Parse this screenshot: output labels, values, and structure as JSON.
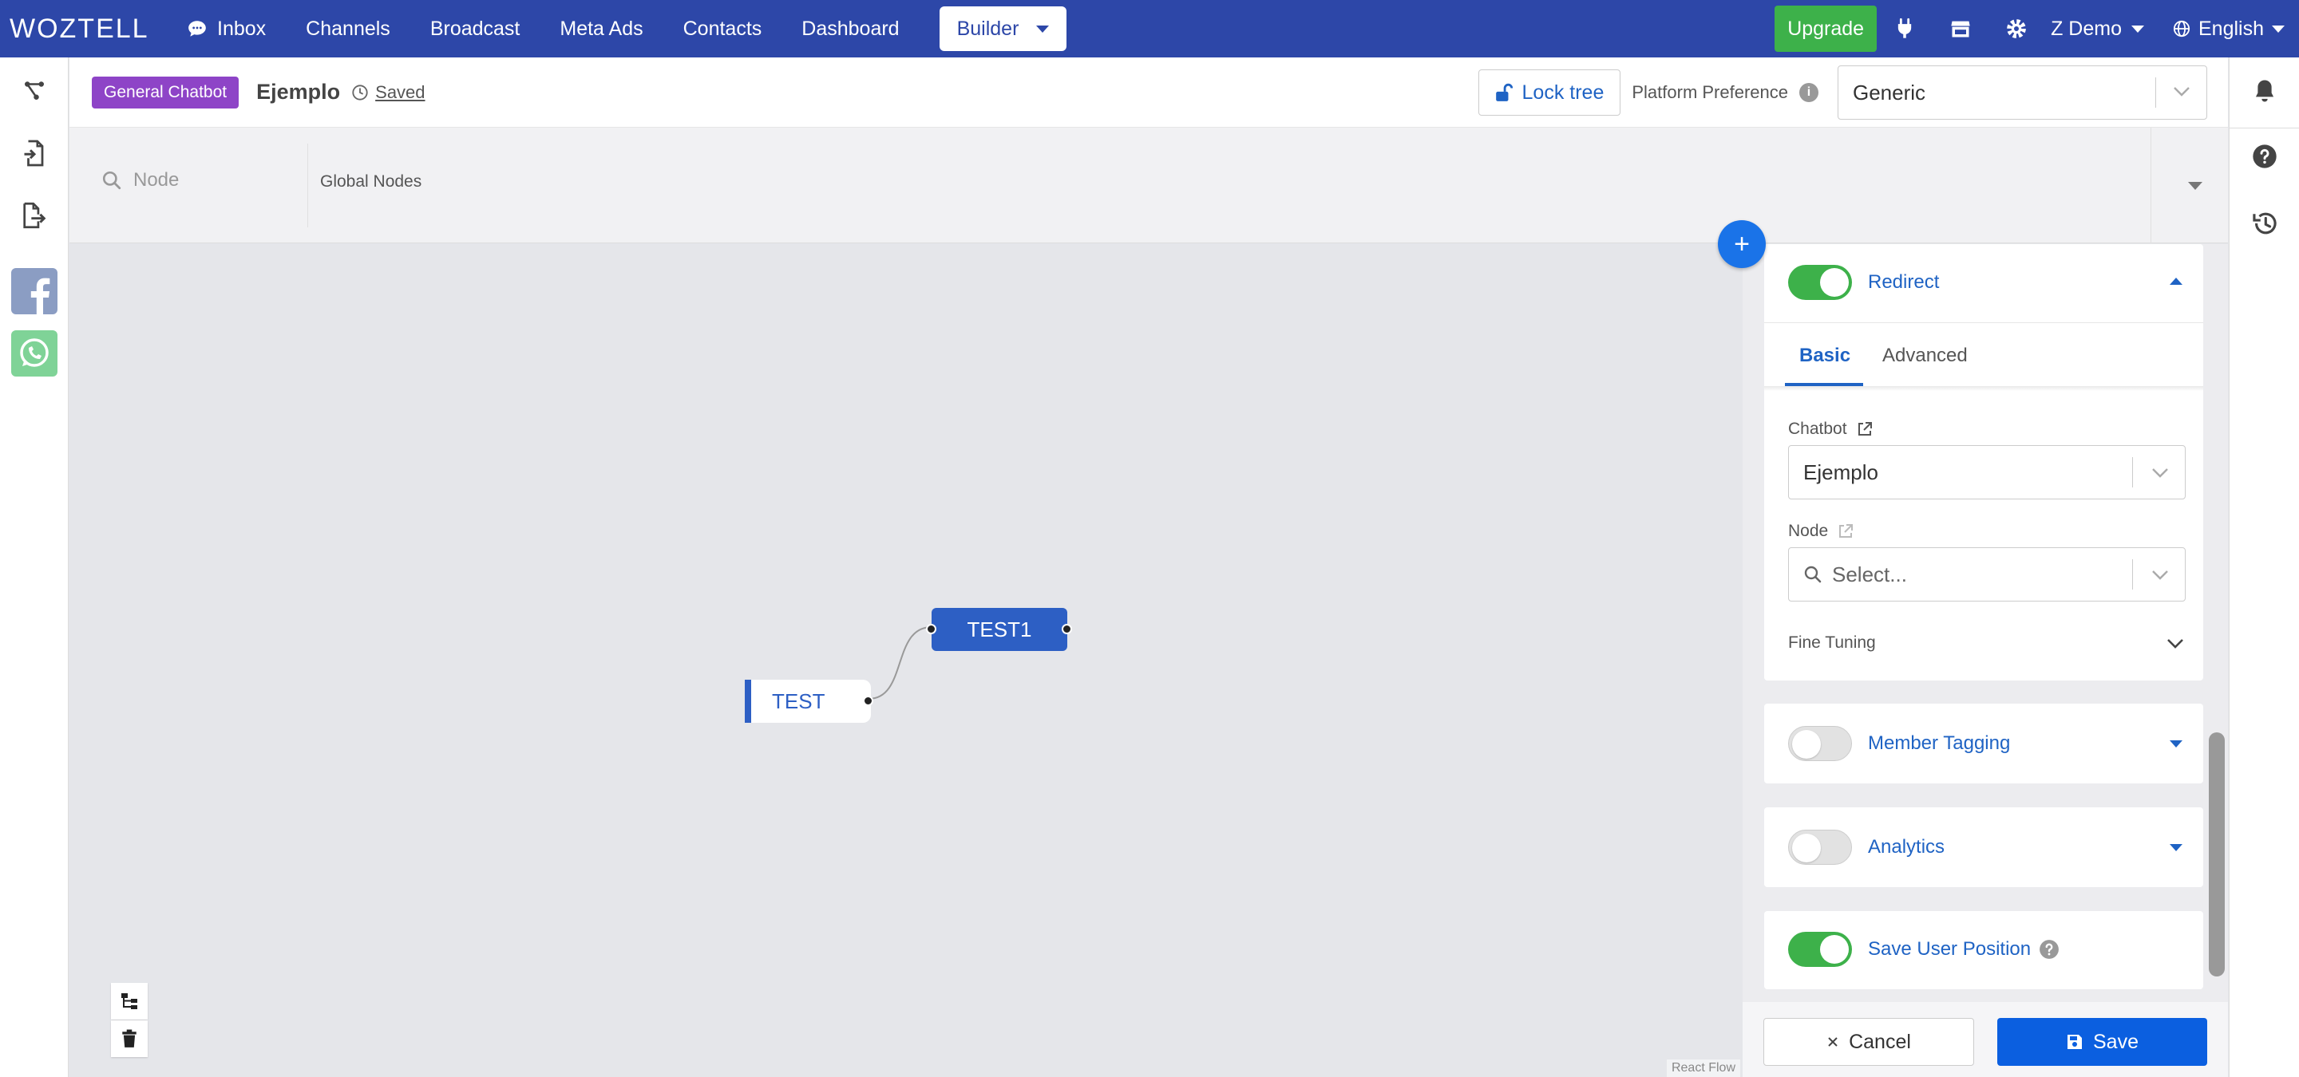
{
  "nav": {
    "logo": "WOZTELL",
    "items": [
      {
        "label": "Inbox"
      },
      {
        "label": "Channels"
      },
      {
        "label": "Broadcast"
      },
      {
        "label": "Meta Ads"
      },
      {
        "label": "Contacts"
      },
      {
        "label": "Dashboard"
      },
      {
        "label": "Builder"
      }
    ],
    "upgrade": "Upgrade",
    "user": "Z Demo",
    "language": "English"
  },
  "header": {
    "badge": "General Chatbot",
    "bot_name": "Ejemplo",
    "saved": "Saved",
    "lock_tree": "Lock tree",
    "platform_label": "Platform Preference",
    "platform_value": "Generic"
  },
  "filter": {
    "search_placeholder": "Node",
    "global_nodes": "Global Nodes"
  },
  "canvas": {
    "nodes": [
      {
        "label": "TEST"
      },
      {
        "label": "TEST1"
      }
    ],
    "watermark": "React Flow"
  },
  "panel": {
    "redirect": {
      "title": "Redirect",
      "enabled": true,
      "tabs": [
        "Basic",
        "Advanced"
      ],
      "chatbot_label": "Chatbot",
      "chatbot_value": "Ejemplo",
      "node_label": "Node",
      "node_placeholder": "Select...",
      "fine_tuning": "Fine Tuning"
    },
    "member_tagging": {
      "title": "Member Tagging",
      "enabled": false
    },
    "analytics": {
      "title": "Analytics",
      "enabled": false
    },
    "save_position": {
      "title": "Save User Position",
      "enabled": true
    },
    "cancel": "Cancel",
    "save": "Save"
  },
  "colors": {
    "brand": "#2d47a8",
    "accent": "#1f63c4",
    "success": "#3db14a",
    "badge": "#8e44c7",
    "primary_button": "#0b5fe0"
  }
}
